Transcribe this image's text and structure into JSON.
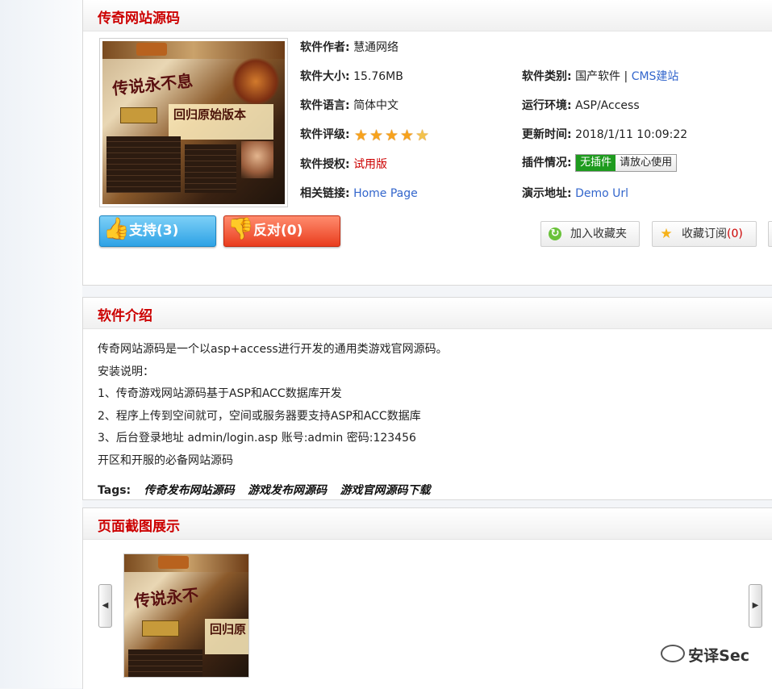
{
  "header": {
    "title": "传奇网站源码"
  },
  "info": {
    "author_label": "软件作者:",
    "author": "慧通网络",
    "size_label": "软件大小:",
    "size": "15.76MB",
    "category_label": "软件类别:",
    "category": "国产软件",
    "category_sep": "|",
    "category_link": "CMS建站",
    "language_label": "软件语言:",
    "language": "简体中文",
    "env_label": "运行环境:",
    "env": "ASP/Access",
    "rating_label": "软件评级:",
    "rating": 4.5,
    "update_label": "更新时间:",
    "update": "2018/1/11 10:09:22",
    "license_label": "软件授权:",
    "license": "试用版",
    "plugin_label": "插件情况:",
    "plugin_green": "无插件",
    "plugin_white": "请放心使用",
    "links_label": "相关链接:",
    "links": "Home Page",
    "demo_label": "演示地址:",
    "demo": "Demo Url"
  },
  "vote": {
    "support": "支持(3)",
    "oppose": "反对(0)"
  },
  "actions": {
    "add_fav": "加入收藏夹",
    "subscribe": "收藏订阅",
    "subscribe_count": "(0)"
  },
  "intro": {
    "title": "软件介绍",
    "lines": [
      "传奇网站源码是一个以asp+access进行开发的通用类游戏官网源码。",
      "安装说明：",
      "1、传奇游戏网站源码基于ASP和ACC数据库开发",
      "2、程序上传到空间就可，空间或服务器要支持ASP和ACC数据库",
      "3、后台登录地址  admin/login.asp   账号:admin 密码:123456",
      "开区和开服的必备网站源码"
    ],
    "tags_label": "Tags:",
    "tags": [
      "传奇发布网站源码",
      "游戏发布网源码",
      "游戏官网源码下载"
    ]
  },
  "screens": {
    "title": "页面截图展示"
  },
  "watermark": "安译Sec",
  "colors": {
    "accent_red": "#cc0000",
    "link_blue": "#3366cc",
    "support_blue": "#2ea2e5",
    "oppose_red": "#e93d1e",
    "plugin_green": "#1e9b1e"
  }
}
